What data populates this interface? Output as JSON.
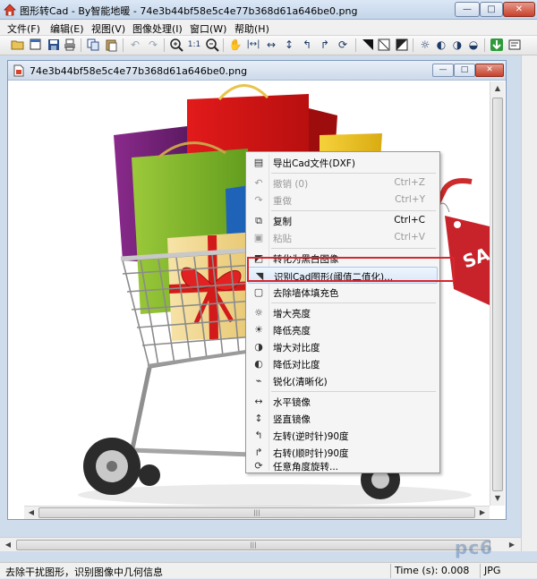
{
  "window": {
    "title": "图形转Cad - By智能地暖 - 74e3b44bf58e5c4e77b368d61a646be0.png",
    "buttons": {
      "minimize": "—",
      "maximize": "□",
      "close": "✕"
    }
  },
  "menubar": {
    "items": [
      {
        "label": "文件(F)"
      },
      {
        "label": "编辑(E)"
      },
      {
        "label": "视图(V)"
      },
      {
        "label": "图像处理(I)"
      },
      {
        "label": "窗口(W)"
      },
      {
        "label": "帮助(H)"
      }
    ]
  },
  "toolbar": {
    "icons": [
      "open-folder-icon",
      "new-window-icon",
      "save-icon",
      "print-icon",
      "copy-icon",
      "paste-icon",
      "undo-icon",
      "redo-icon",
      "zoom-in-icon",
      "actual-size-icon",
      "zoom-out-icon",
      "pan-hand-icon",
      "fit-width-icon",
      "mirror-horizontal-icon",
      "mirror-vertical-icon",
      "rotate-left-icon",
      "rotate-right-icon",
      "rotate-free-icon",
      "threshold-icon",
      "remove-fill-icon",
      "black-white-icon",
      "brightness-up-icon",
      "brightness-down-icon",
      "contrast-icon",
      "contrast-down-icon",
      "fullscreen-icon",
      "export-icon",
      "settings-icon"
    ]
  },
  "document": {
    "title": "74e3b44bf58e5c4e77b368d61a646be0.png",
    "buttons": {
      "minimize": "—",
      "maximize": "□",
      "close": "✕"
    }
  },
  "context_menu": {
    "items": [
      {
        "icon": "export-dxf-icon",
        "label": "导出Cad文件(DXF)",
        "shortcut": "",
        "disabled": false
      },
      {
        "separator": true
      },
      {
        "icon": "undo-icon",
        "label": "撤销 (0)",
        "shortcut": "Ctrl+Z",
        "disabled": true
      },
      {
        "icon": "redo-icon",
        "label": "重做",
        "shortcut": "Ctrl+Y",
        "disabled": true
      },
      {
        "separator": true
      },
      {
        "icon": "copy-icon",
        "label": "复制",
        "shortcut": "Ctrl+C",
        "disabled": false
      },
      {
        "icon": "paste-icon",
        "label": "粘贴",
        "shortcut": "Ctrl+V",
        "disabled": true
      },
      {
        "separator": true
      },
      {
        "icon": "black-white-icon",
        "label": "转化为黑白图像",
        "shortcut": "",
        "disabled": false
      },
      {
        "icon": "threshold-icon",
        "label": "识别Cad图形(阈值二值化)...",
        "shortcut": "",
        "disabled": false,
        "hover": true
      },
      {
        "icon": "remove-fill-icon",
        "label": "去除墙体填充色",
        "shortcut": "",
        "disabled": false
      },
      {
        "separator": true
      },
      {
        "icon": "brightness-up-icon",
        "label": "增大亮度",
        "shortcut": "",
        "disabled": false
      },
      {
        "icon": "brightness-down-icon",
        "label": "降低亮度",
        "shortcut": "",
        "disabled": false
      },
      {
        "icon": "contrast-up-icon",
        "label": "增大对比度",
        "shortcut": "",
        "disabled": false
      },
      {
        "icon": "contrast-down-icon",
        "label": "降低对比度",
        "shortcut": "",
        "disabled": false
      },
      {
        "icon": "sharpen-icon",
        "label": "锐化(清晰化)",
        "shortcut": "",
        "disabled": false
      },
      {
        "separator": true
      },
      {
        "icon": "mirror-horizontal-icon",
        "label": "水平镜像",
        "shortcut": "",
        "disabled": false
      },
      {
        "icon": "mirror-vertical-icon",
        "label": "竖直镜像",
        "shortcut": "",
        "disabled": false
      },
      {
        "icon": "rotate-left-icon",
        "label": "左转(逆时针)90度",
        "shortcut": "",
        "disabled": false
      },
      {
        "icon": "rotate-right-icon",
        "label": "右转(顺时针)90度",
        "shortcut": "",
        "disabled": false
      },
      {
        "icon": "rotate-free-icon",
        "label": "任意角度旋转...",
        "shortcut": "",
        "disabled": false
      }
    ]
  },
  "image": {
    "sale_tag": "SA"
  },
  "statusbar": {
    "message": "去除干扰图形，识别图像中几何信息",
    "time": "Time (s): 0.008",
    "format": "JPG"
  },
  "watermark": "pc6",
  "colors": {
    "highlight_box": "#d8262c",
    "menu_hover": "#d9e8f9",
    "title_gradient": "#c4d5ea"
  }
}
